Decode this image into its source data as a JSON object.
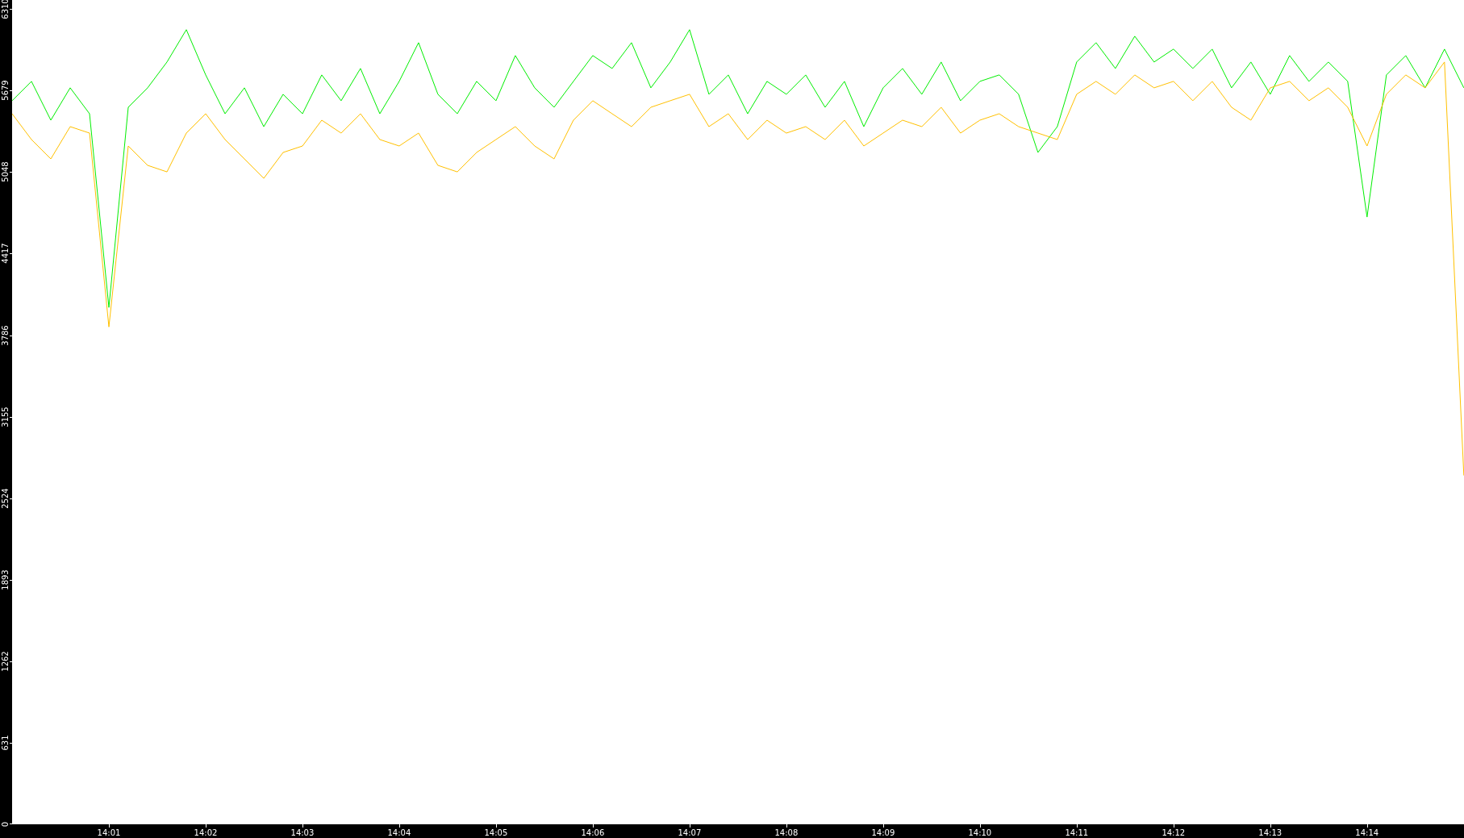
{
  "chart": {
    "chart_data": {
      "type": "line",
      "categories": [
        null,
        null,
        null,
        null,
        null,
        "14:01",
        null,
        null,
        null,
        null,
        "14:02",
        null,
        null,
        null,
        null,
        "14:03",
        null,
        null,
        null,
        null,
        "14:04",
        null,
        null,
        null,
        null,
        "14:05",
        null,
        null,
        null,
        null,
        "14:06",
        null,
        null,
        null,
        null,
        "14:07",
        null,
        null,
        null,
        null,
        "14:08",
        null,
        null,
        null,
        null,
        "14:09",
        null,
        null,
        null,
        null,
        "14:10",
        null,
        null,
        null,
        null,
        "14:11",
        null,
        null,
        null,
        null,
        "14:12",
        null,
        null,
        null,
        null,
        "14:13",
        null,
        null,
        null,
        null,
        "14:14",
        null,
        null,
        null,
        null,
        null
      ],
      "ylim": [
        0,
        6380
      ],
      "yticks": [
        6310,
        5679,
        5048,
        4417,
        3786,
        3155,
        2524,
        1893,
        1262,
        631,
        0
      ],
      "series": [
        {
          "color": "#00ee00",
          "values": [
            5600,
            5750,
            5450,
            5700,
            5500,
            4000,
            5550,
            5700,
            5900,
            6150,
            5800,
            5500,
            5700,
            5400,
            5650,
            5500,
            5800,
            5600,
            5850,
            5500,
            5750,
            6050,
            5650,
            5500,
            5750,
            5600,
            5950,
            5700,
            5550,
            5750,
            5950,
            5850,
            6050,
            5700,
            5900,
            6150,
            5650,
            5800,
            5500,
            5750,
            5650,
            5800,
            5550,
            5750,
            5400,
            5700,
            5850,
            5650,
            5900,
            5600,
            5750,
            5800,
            5650,
            5200,
            5400,
            5900,
            6050,
            5850,
            6100,
            5900,
            6000,
            5850,
            6000,
            5700,
            5900,
            5650,
            5950,
            5750,
            5900,
            5750,
            4700,
            5800,
            5950,
            5700,
            6000,
            5700
          ]
        },
        {
          "color": "#ffc000",
          "values": [
            5500,
            5300,
            5150,
            5400,
            5350,
            3850,
            5250,
            5100,
            5050,
            5350,
            5500,
            5300,
            5150,
            5000,
            5200,
            5250,
            5450,
            5350,
            5500,
            5300,
            5250,
            5350,
            5100,
            5050,
            5200,
            5300,
            5400,
            5250,
            5150,
            5450,
            5600,
            5500,
            5400,
            5550,
            5600,
            5650,
            5400,
            5500,
            5300,
            5450,
            5350,
            5400,
            5300,
            5450,
            5250,
            5350,
            5450,
            5400,
            5550,
            5350,
            5450,
            5500,
            5400,
            5350,
            5300,
            5650,
            5750,
            5650,
            5800,
            5700,
            5750,
            5600,
            5750,
            5550,
            5450,
            5700,
            5750,
            5600,
            5700,
            5550,
            5250,
            5650,
            5800,
            5700,
            5900,
            2700
          ]
        }
      ]
    }
  }
}
